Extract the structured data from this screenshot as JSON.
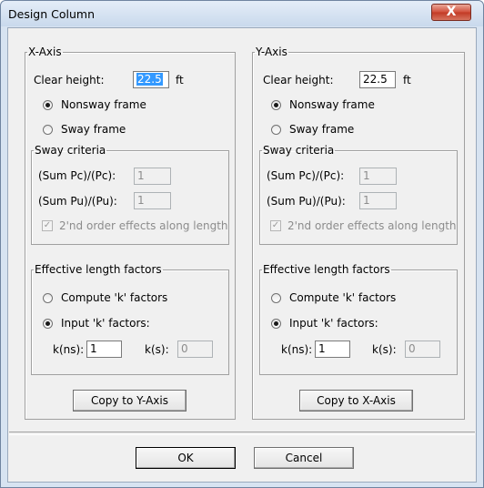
{
  "window": {
    "title": "Design Column",
    "close_symbol": "X"
  },
  "x_axis": {
    "title": "X-Axis",
    "clear_height_label": "Clear height:",
    "clear_height_value": "22.5",
    "unit": "ft",
    "frame_options": [
      "Nonsway frame",
      "Sway frame"
    ],
    "frame_selected": "Nonsway frame",
    "sway_criteria": {
      "title": "Sway criteria",
      "pc_label": "(Sum Pc)/(Pc):",
      "pc_value": "1",
      "pu_label": "(Sum Pu)/(Pu):",
      "pu_value": "1",
      "second_order_label": "2'nd order effects along length",
      "second_order_checked": true
    },
    "effective_length": {
      "title": "Effective length factors",
      "compute_label": "Compute 'k' factors",
      "input_label": "Input 'k' factors:",
      "selected": "Input 'k' factors:",
      "kns_label": "k(ns):",
      "kns_value": "1",
      "ks_label": "k(s):",
      "ks_value": "0"
    },
    "copy_button": "Copy to Y-Axis"
  },
  "y_axis": {
    "title": "Y-Axis",
    "clear_height_label": "Clear height:",
    "clear_height_value": "22.5",
    "unit": "ft",
    "frame_options": [
      "Nonsway frame",
      "Sway frame"
    ],
    "frame_selected": "Nonsway frame",
    "sway_criteria": {
      "title": "Sway criteria",
      "pc_label": "(Sum Pc)/(Pc):",
      "pc_value": "1",
      "pu_label": "(Sum Pu)/(Pu):",
      "pu_value": "1",
      "second_order_label": "2'nd order effects along length",
      "second_order_checked": true
    },
    "effective_length": {
      "title": "Effective length factors",
      "compute_label": "Compute 'k' factors",
      "input_label": "Input 'k' factors:",
      "selected": "Input 'k' factors:",
      "kns_label": "k(ns):",
      "kns_value": "1",
      "ks_label": "k(s):",
      "ks_value": "0"
    },
    "copy_button": "Copy to X-Axis"
  },
  "buttons": {
    "ok": "OK",
    "cancel": "Cancel"
  }
}
